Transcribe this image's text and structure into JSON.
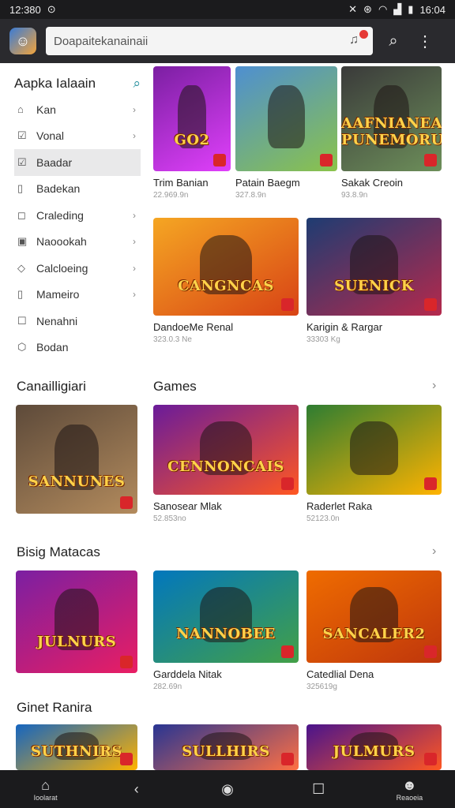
{
  "status": {
    "time_left": "12:380",
    "time_right": "16:04"
  },
  "search": {
    "value": "Doapaitekanainaii"
  },
  "sidebar": {
    "title": "Aapka Ialaain",
    "items": [
      {
        "label": "Kan",
        "icon": "home-icon"
      },
      {
        "label": "Vonal",
        "icon": "check-box-icon"
      },
      {
        "label": "Baadar",
        "icon": "check-box-icon",
        "active": true
      },
      {
        "label": "Badekan",
        "icon": "bookmark-icon"
      },
      {
        "label": "Craleding",
        "icon": "chat-icon"
      },
      {
        "label": "Naoookah",
        "icon": "puzzle-icon"
      },
      {
        "label": "Calcloeing",
        "icon": "tag-icon"
      },
      {
        "label": "Mameiro",
        "icon": "bookmark-icon"
      },
      {
        "label": "Nenahni",
        "icon": "square-icon"
      },
      {
        "label": "Bodan",
        "icon": "shield-icon"
      }
    ]
  },
  "top_cards": [
    {
      "title": "Trim Banian",
      "sub": "22.969.9n",
      "art": "GO2",
      "colors": [
        "#7b1fa2",
        "#e040fb"
      ]
    },
    {
      "title": "Patain Baegm",
      "sub": "327.8.9n",
      "art": "",
      "colors": [
        "#4e8fd1",
        "#8bc34a"
      ]
    },
    {
      "title": "Sakak Creoin",
      "sub": "93.8.9n",
      "art": "AAFNIANEA PUNEMORUA",
      "colors": [
        "#3a3a3a",
        "#6d8f5a"
      ]
    }
  ],
  "mid_cards": [
    {
      "title": "DandoeMe Renal",
      "sub": "323.0.3 Ne",
      "art": "CANGNCAS",
      "colors": [
        "#f5a623",
        "#d84315"
      ]
    },
    {
      "title": "Karigin & Rargar",
      "sub": "33303 Kg",
      "art": "SUENICK",
      "colors": [
        "#1e3c72",
        "#b5294c"
      ]
    }
  ],
  "sections": {
    "left1": "Canailligiari",
    "games": "Games",
    "bisig": "Bisig Matacas",
    "ginet": "Ginet Ranira"
  },
  "games_row": [
    {
      "title": "",
      "sub": "",
      "art": "SANNUNES",
      "colors": [
        "#5d4a3a",
        "#b38b5d"
      ]
    },
    {
      "title": "Sanosear Mlak",
      "sub": "52.853no",
      "art": "CENNONCAIS",
      "colors": [
        "#6a1b9a",
        "#ff5722"
      ]
    },
    {
      "title": "Raderlet Raka",
      "sub": "52123.0n",
      "art": "",
      "colors": [
        "#2e7d32",
        "#ffb300"
      ]
    }
  ],
  "bisig_row": [
    {
      "title": "",
      "sub": "",
      "art": "JULNURS",
      "colors": [
        "#7b1fa2",
        "#e91e63"
      ]
    },
    {
      "title": "Garddela Nitak",
      "sub": "282.69n",
      "art": "NANNOBEE",
      "colors": [
        "#0277bd",
        "#43a047"
      ]
    },
    {
      "title": "Catedlial Dena",
      "sub": "325619g",
      "art": "SANCALER2",
      "colors": [
        "#ef6c00",
        "#bf360c"
      ]
    }
  ],
  "ginet_row": [
    {
      "art": "SUTHNIRS",
      "colors": [
        "#1565c0",
        "#ffb300"
      ]
    },
    {
      "art": "SULLHIRS",
      "colors": [
        "#283593",
        "#ff7043"
      ]
    },
    {
      "art": "JULMURS",
      "colors": [
        "#4a148c",
        "#ff5722"
      ]
    }
  ],
  "navbar": [
    {
      "label": "Ioolarat",
      "icon": "home-icon"
    },
    {
      "label": "",
      "icon": "back-icon"
    },
    {
      "label": "",
      "icon": "circle-icon"
    },
    {
      "label": "",
      "icon": "square-icon"
    },
    {
      "label": "Reaoeia",
      "icon": "profile-icon"
    }
  ]
}
